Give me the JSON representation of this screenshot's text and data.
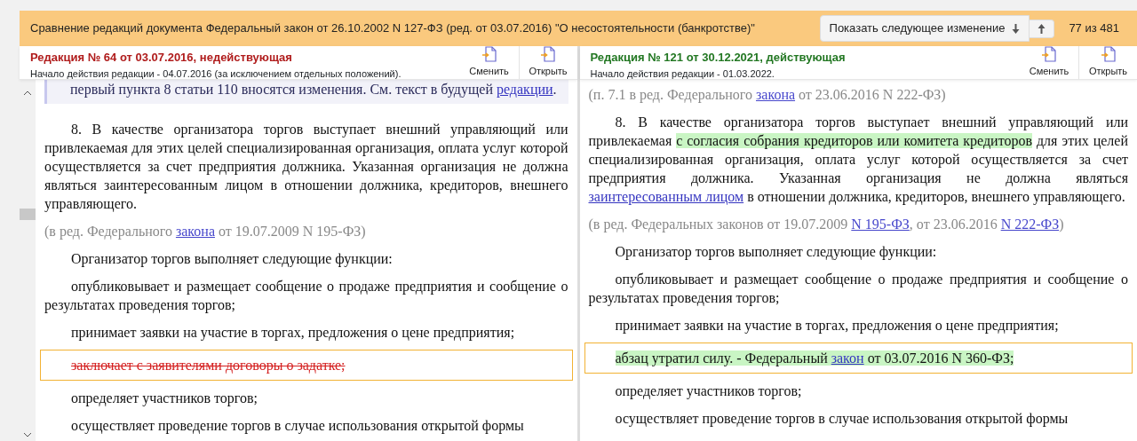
{
  "header": {
    "title": "Сравнение редакций документа Федеральный закон от 26.10.2002 N 127-ФЗ (ред. от 03.07.2016) \"О несостоятельности (банкротстве)\"",
    "next_button": "Показать следующее изменение",
    "counter": "77 из 481"
  },
  "panes": [
    {
      "edition": "Редакция № 64 от 03.07.2016, недействующая",
      "current": false,
      "start": "Начало действия редакции - 04.07.2016 (за исключением отдельных положений).",
      "actions": [
        "Сменить",
        "Открыть"
      ],
      "scrollbar": true,
      "paragraphs": [
        {
          "kind": "note",
          "changed": false,
          "parts": [
            {
              "kind": "text",
              "text": "первый пункта 8 статьи 110 вносятся изменения. См. текст в будущей "
            },
            {
              "kind": "link",
              "text": "редакции"
            },
            {
              "kind": "text",
              "text": "."
            }
          ]
        },
        {
          "kind": "body",
          "changed": false,
          "parts": [
            {
              "kind": "text",
              "text": "8. В качестве организатора торгов выступает внешний управляющий или привлекаемая для этих целей специализированная организация, оплата услуг которой осуществляется за счет предприятия должника. Указанная организация не должна являться заинтересованным лицом в отношении должника, кредиторов, внешнего управляющего."
            }
          ]
        },
        {
          "kind": "edition",
          "changed": false,
          "parts": [
            {
              "kind": "text",
              "text": "(в ред. Федерального "
            },
            {
              "kind": "link",
              "text": "закона"
            },
            {
              "kind": "text",
              "text": " от 19.07.2009 N 195-ФЗ)"
            }
          ]
        },
        {
          "kind": "body",
          "changed": false,
          "parts": [
            {
              "kind": "text",
              "text": "Организатор торгов выполняет следующие функции:"
            }
          ]
        },
        {
          "kind": "body",
          "changed": false,
          "parts": [
            {
              "kind": "text",
              "text": "опубликовывает и размещает сообщение о продаже предприятия и сообщение о результатах проведения торгов;"
            }
          ]
        },
        {
          "kind": "body",
          "changed": false,
          "parts": [
            {
              "kind": "text",
              "text": "принимает заявки на участие в торгах, предложения о цене предприятия;"
            }
          ]
        },
        {
          "kind": "body",
          "changed": true,
          "parts": [
            {
              "kind": "removed",
              "text": "заключает с заявителями договоры о задатке;"
            }
          ]
        },
        {
          "kind": "body",
          "changed": false,
          "parts": [
            {
              "kind": "text",
              "text": "определяет участников торгов;"
            }
          ]
        },
        {
          "kind": "body",
          "changed": false,
          "parts": [
            {
              "kind": "text",
              "text": "осуществляет проведение торгов в случае использования открытой формы"
            }
          ]
        }
      ]
    },
    {
      "edition": "Редакция № 121 от 30.12.2021, действующая",
      "current": true,
      "start": "Начало действия редакции - 01.03.2022.",
      "actions": [
        "Сменить",
        "Открыть"
      ],
      "scrollbar": false,
      "paragraphs": [
        {
          "kind": "edition",
          "changed": false,
          "parts": [
            {
              "kind": "text",
              "text": "(п. 7.1 в ред. Федерального "
            },
            {
              "kind": "link",
              "text": "закона"
            },
            {
              "kind": "text",
              "text": " от 23.06.2016 N 222-ФЗ)"
            }
          ]
        },
        {
          "kind": "body",
          "changed": false,
          "parts": [
            {
              "kind": "text",
              "text": "8. В качестве организатора торгов выступает внешний управляющий или привлекаемая "
            },
            {
              "kind": "added",
              "text": "с согласия собрания кредиторов или комитета кредиторов"
            },
            {
              "kind": "text",
              "text": " для этих целей специализированная организация, оплата услуг которой осуществляется за счет предприятия должника. Указанная организация не должна являться "
            },
            {
              "kind": "link",
              "text": "заинтересованным лицом"
            },
            {
              "kind": "text",
              "text": " в отношении должника, кредиторов, внешнего управляющего."
            }
          ]
        },
        {
          "kind": "edition",
          "changed": false,
          "parts": [
            {
              "kind": "text",
              "text": "(в ред. Федеральных законов от 19.07.2009 "
            },
            {
              "kind": "link",
              "text": "N 195-ФЗ"
            },
            {
              "kind": "text",
              "text": ", от 23.06.2016 "
            },
            {
              "kind": "link",
              "text": "N 222-ФЗ"
            },
            {
              "kind": "text",
              "text": ")"
            }
          ]
        },
        {
          "kind": "body",
          "changed": false,
          "parts": [
            {
              "kind": "text",
              "text": "Организатор торгов выполняет следующие функции:"
            }
          ]
        },
        {
          "kind": "body",
          "changed": false,
          "parts": [
            {
              "kind": "text",
              "text": "опубликовывает и размещает сообщение о продаже предприятия и сообщение о результатах проведения торгов;"
            }
          ]
        },
        {
          "kind": "body",
          "changed": false,
          "parts": [
            {
              "kind": "text",
              "text": "принимает заявки на участие в торгах, предложения о цене предприятия;"
            }
          ]
        },
        {
          "kind": "body",
          "changed": true,
          "parts": [
            {
              "kind": "added",
              "text": "абзац утратил силу. - Федеральный "
            },
            {
              "kind": "link",
              "text": "закон"
            },
            {
              "kind": "added",
              "text": " от 03.07.2016 N 360-ФЗ;"
            }
          ]
        },
        {
          "kind": "body",
          "changed": false,
          "parts": [
            {
              "kind": "text",
              "text": "определяет участников торгов;"
            }
          ]
        },
        {
          "kind": "body",
          "changed": false,
          "parts": [
            {
              "kind": "text",
              "text": "осуществляет проведение торгов в случае использования открытой формы"
            }
          ]
        }
      ]
    }
  ]
}
